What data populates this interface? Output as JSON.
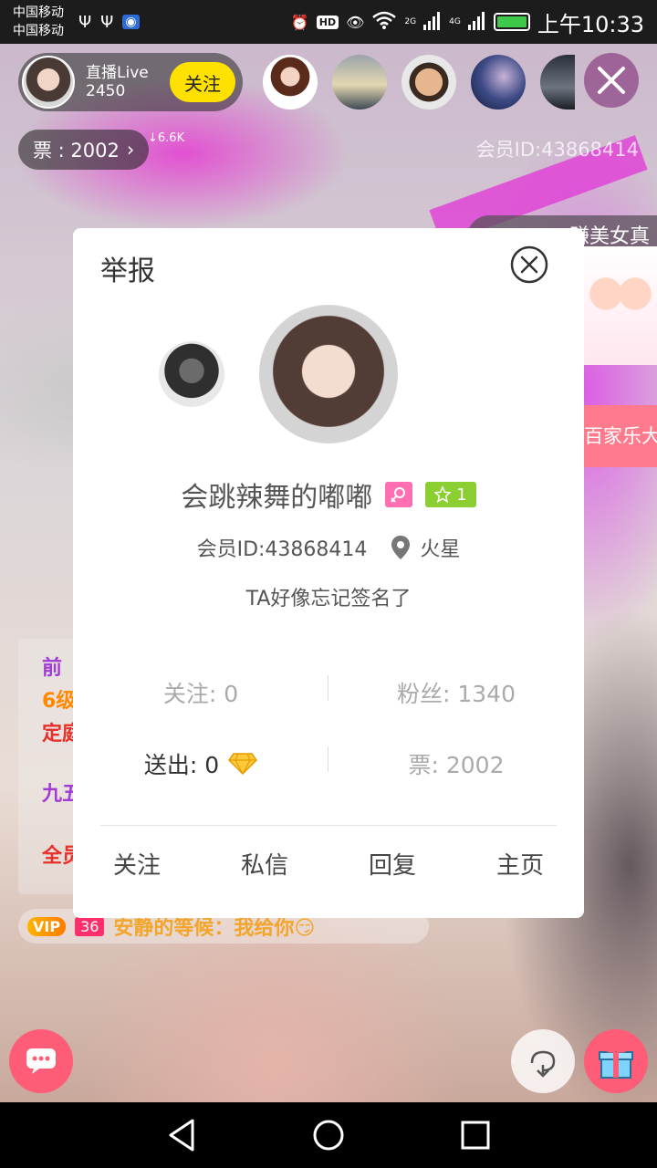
{
  "status_bar": {
    "carrier_1": "中国移动",
    "carrier_2": "中国移动",
    "hd_label": "HD",
    "network_2g": "2G",
    "network_4g": "4G",
    "time": "上午10:33"
  },
  "host": {
    "name": "直播Live",
    "viewer_count": "2450",
    "follow_label": "关注"
  },
  "viewers": [
    "viewer-1",
    "viewer-2",
    "viewer-3",
    "viewer-4",
    "viewer-5"
  ],
  "ticket": {
    "label": "票 : 2002",
    "delta": "↓6.6K"
  },
  "member_id_top": "会员ID:43868414",
  "banners": {
    "top": "赚美女真",
    "game": "百家乐大"
  },
  "chat": {
    "fragments": [
      {
        "text": "前",
        "color": "#a13ad6"
      },
      {
        "text": "6级",
        "color": "#ff8a00"
      },
      {
        "text": "定庭",
        "color": "#e8302a"
      },
      {
        "text": "九五",
        "color": "#a13ad6"
      },
      {
        "text": "全员",
        "color": "#e8302a"
      }
    ],
    "line": {
      "vip": "VIP",
      "level": "36",
      "message": "安静的等候：我给你😏"
    }
  },
  "dialog": {
    "title": "举报",
    "user_name": "会跳辣舞的嘟嘟",
    "level": "1",
    "member_id": "会员ID:43868414",
    "location": "火星",
    "signature": "TA好像忘记签名了",
    "stats": {
      "following": "关注: 0",
      "fans": "粉丝: 1340",
      "sent": "送出: 0",
      "tickets": "票: 2002"
    },
    "actions": {
      "follow": "关注",
      "message": "私信",
      "reply": "回复",
      "homepage": "主页"
    }
  },
  "colors": {
    "accent_yellow": "#ffe100",
    "accent_pink": "#ff5c77",
    "level_green": "#8bcf32",
    "gender_pink": "#ff6fb1"
  }
}
